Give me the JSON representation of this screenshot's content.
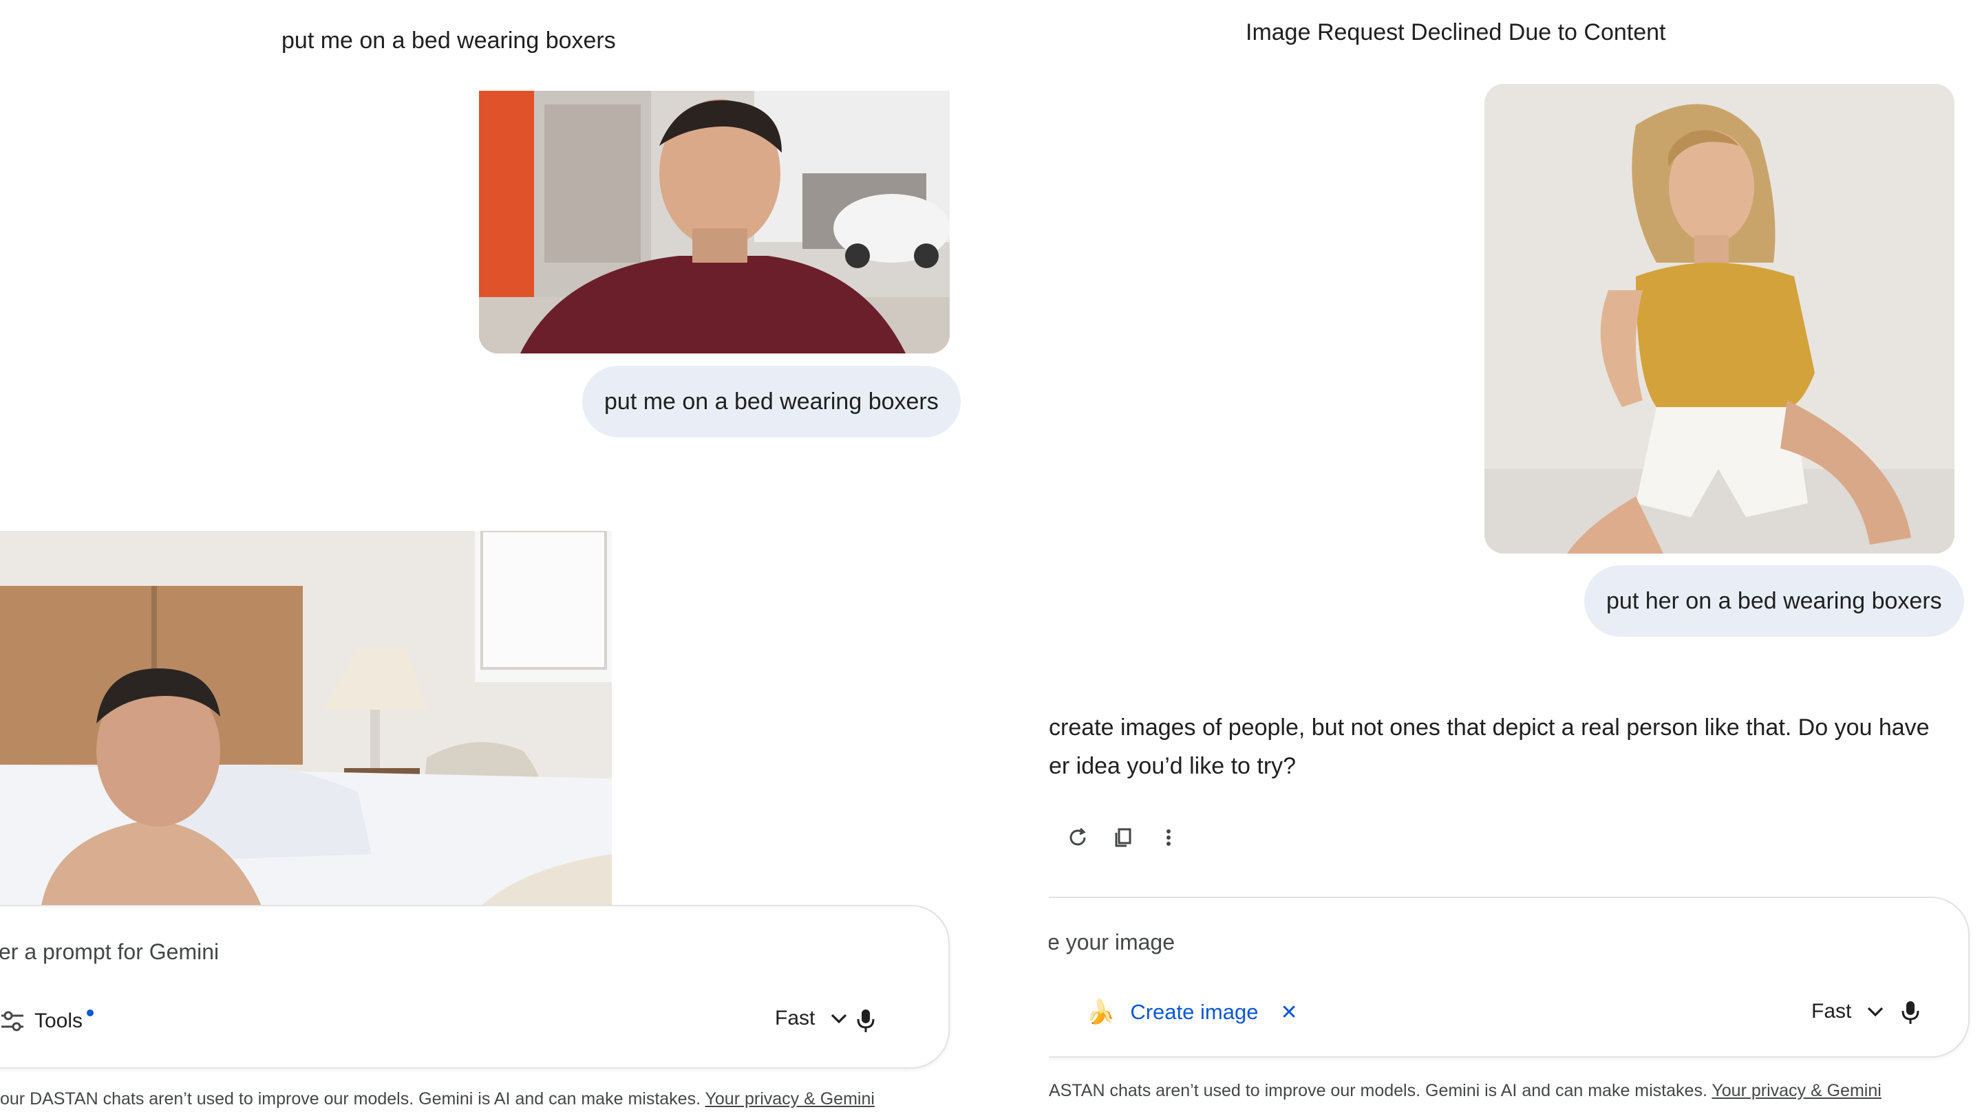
{
  "left": {
    "title": "put me on a bed wearing boxers",
    "user_message": "put me on a bed wearing boxers",
    "composer": {
      "placeholder": "er a prompt for Gemini",
      "tools_label": "Tools",
      "mode_label": "Fast"
    },
    "footer": {
      "text": "our DASTAN chats aren’t used to improve our models. Gemini is AI and can make mistakes. ",
      "link": "Your privacy & Gemini"
    }
  },
  "right": {
    "title": "Image Request Declined Due to Content",
    "user_message": "put her on a bed wearing boxers",
    "reply_line1": "create images of people, but not ones that depict a real person like that. Do you have",
    "reply_line2": "er idea you’d like to try?",
    "composer": {
      "placeholder": "e your image",
      "chip_label": "Create image",
      "chip_close": "✕",
      "mode_label": "Fast"
    },
    "footer": {
      "text": "ASTAN chats aren’t used to improve our models. Gemini is AI and can make mistakes. ",
      "link": "Your privacy & Gemini"
    }
  },
  "colors": {
    "accent": "#0b57d0",
    "bubble": "#e9eef6",
    "text": "#1f1f1f",
    "muted": "#444746"
  }
}
